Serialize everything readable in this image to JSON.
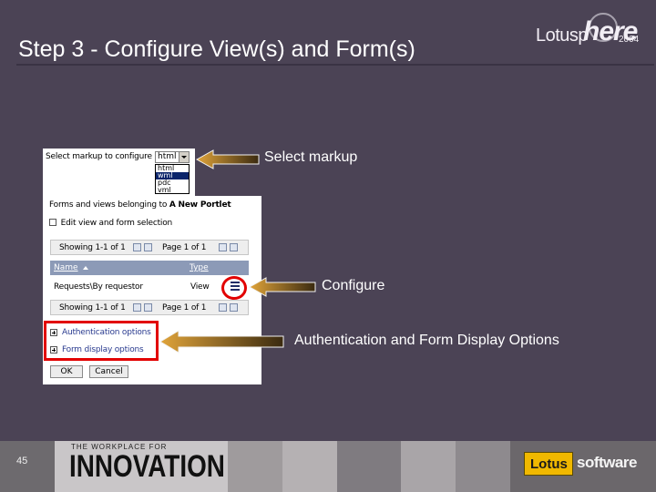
{
  "slide": {
    "title": "Step 3 - Configure View(s) and Form(s)",
    "page_number": "45",
    "colors": {
      "background": "#4b4355",
      "highlight": "#e20000",
      "arrow": "#c98a24"
    }
  },
  "logo": {
    "lotus": "Lotusp",
    "here": "here",
    "year": "2004"
  },
  "markup_panel": {
    "label": "Select markup to configure",
    "selected": "html",
    "options": [
      "html",
      "wml",
      "pdc",
      "vml"
    ]
  },
  "forms_panel": {
    "heading_prefix": "Forms and views belonging to",
    "heading_name": "A New Portlet",
    "edit_link": "Edit view and form selection",
    "pager_top": {
      "showing": "Showing 1-1 of 1",
      "page": "Page 1 of 1"
    },
    "pager_bottom": {
      "showing": "Showing 1-1 of 1",
      "page": "Page 1 of 1"
    },
    "columns": [
      "Name",
      "Type"
    ],
    "rows": [
      {
        "name": "Requests\\By requestor",
        "type": "View"
      }
    ],
    "options": [
      "Authentication options",
      "Form display options"
    ],
    "ok_label": "OK",
    "cancel_label": "Cancel"
  },
  "callouts": {
    "select_markup": "Select markup",
    "configure": "Configure",
    "auth_display": "Authentication and Form Display Options"
  },
  "footer": {
    "tagline": "THE WORKPLACE FOR",
    "brand": "INNOVATION",
    "lotus": "Lotus",
    "software": "software"
  }
}
